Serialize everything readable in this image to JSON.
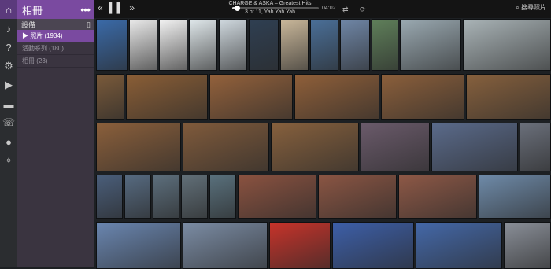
{
  "app": {
    "title": "相冊",
    "menu_icon": "more-icon"
  },
  "rail": {
    "icons": [
      "home-icon",
      "music-note-icon",
      "help-icon",
      "gear-icon",
      "play-icon",
      "folder-icon",
      "phone-icon",
      "person-icon",
      "location-pin-icon"
    ]
  },
  "sidebar": {
    "device_label": "設備",
    "items": [
      {
        "label": "▶ 照片 (1934)"
      },
      {
        "label": "活動系列 (180)"
      },
      {
        "label": "相冊 (23)"
      }
    ]
  },
  "player": {
    "track_title": "CHARGE & ASKA – Greatest Hits",
    "track_sub": "3 of 11, Yah Yah Yah",
    "time_elapsed": "",
    "time_remaining": "04:02",
    "progress": 0.05,
    "search_label": "搜尋照片"
  },
  "gallery": {
    "rows": [
      {
        "photos": [
          "screenshot-phone-home",
          "screenshot-handwritten-note",
          "screenshot-white-app",
          "screenshot-chat",
          "screenshot-settings",
          "screenshot-keypad",
          "screenshot-notebook",
          "screenshot-menu",
          "photo-sky-tower",
          "photo-trees",
          "photo-rooftop-1",
          "photo-rooftop-2"
        ]
      },
      {
        "photos": [
          "photo-toddler-1",
          "photo-toddler-2",
          "photo-toddler-3",
          "photo-toddler-4",
          "photo-toddler-5",
          "photo-toddler-6"
        ]
      },
      {
        "photos": [
          "photo-toddler-7",
          "photo-toddler-8",
          "photo-toddler-9",
          "photo-child-portrait",
          "photo-man-child",
          "photo-child-cap"
        ]
      },
      {
        "photos": [
          "photo-family-1",
          "photo-family-2",
          "photo-family-3",
          "photo-family-4",
          "photo-family-5",
          "photo-temple-1",
          "photo-temple-2",
          "photo-temple-3",
          "photo-garden"
        ]
      },
      {
        "photos": [
          "photo-blossoms",
          "photo-bare-tree",
          "photo-red-scroll",
          "photo-baby-1",
          "photo-baby-2",
          "photo-street"
        ]
      }
    ]
  }
}
